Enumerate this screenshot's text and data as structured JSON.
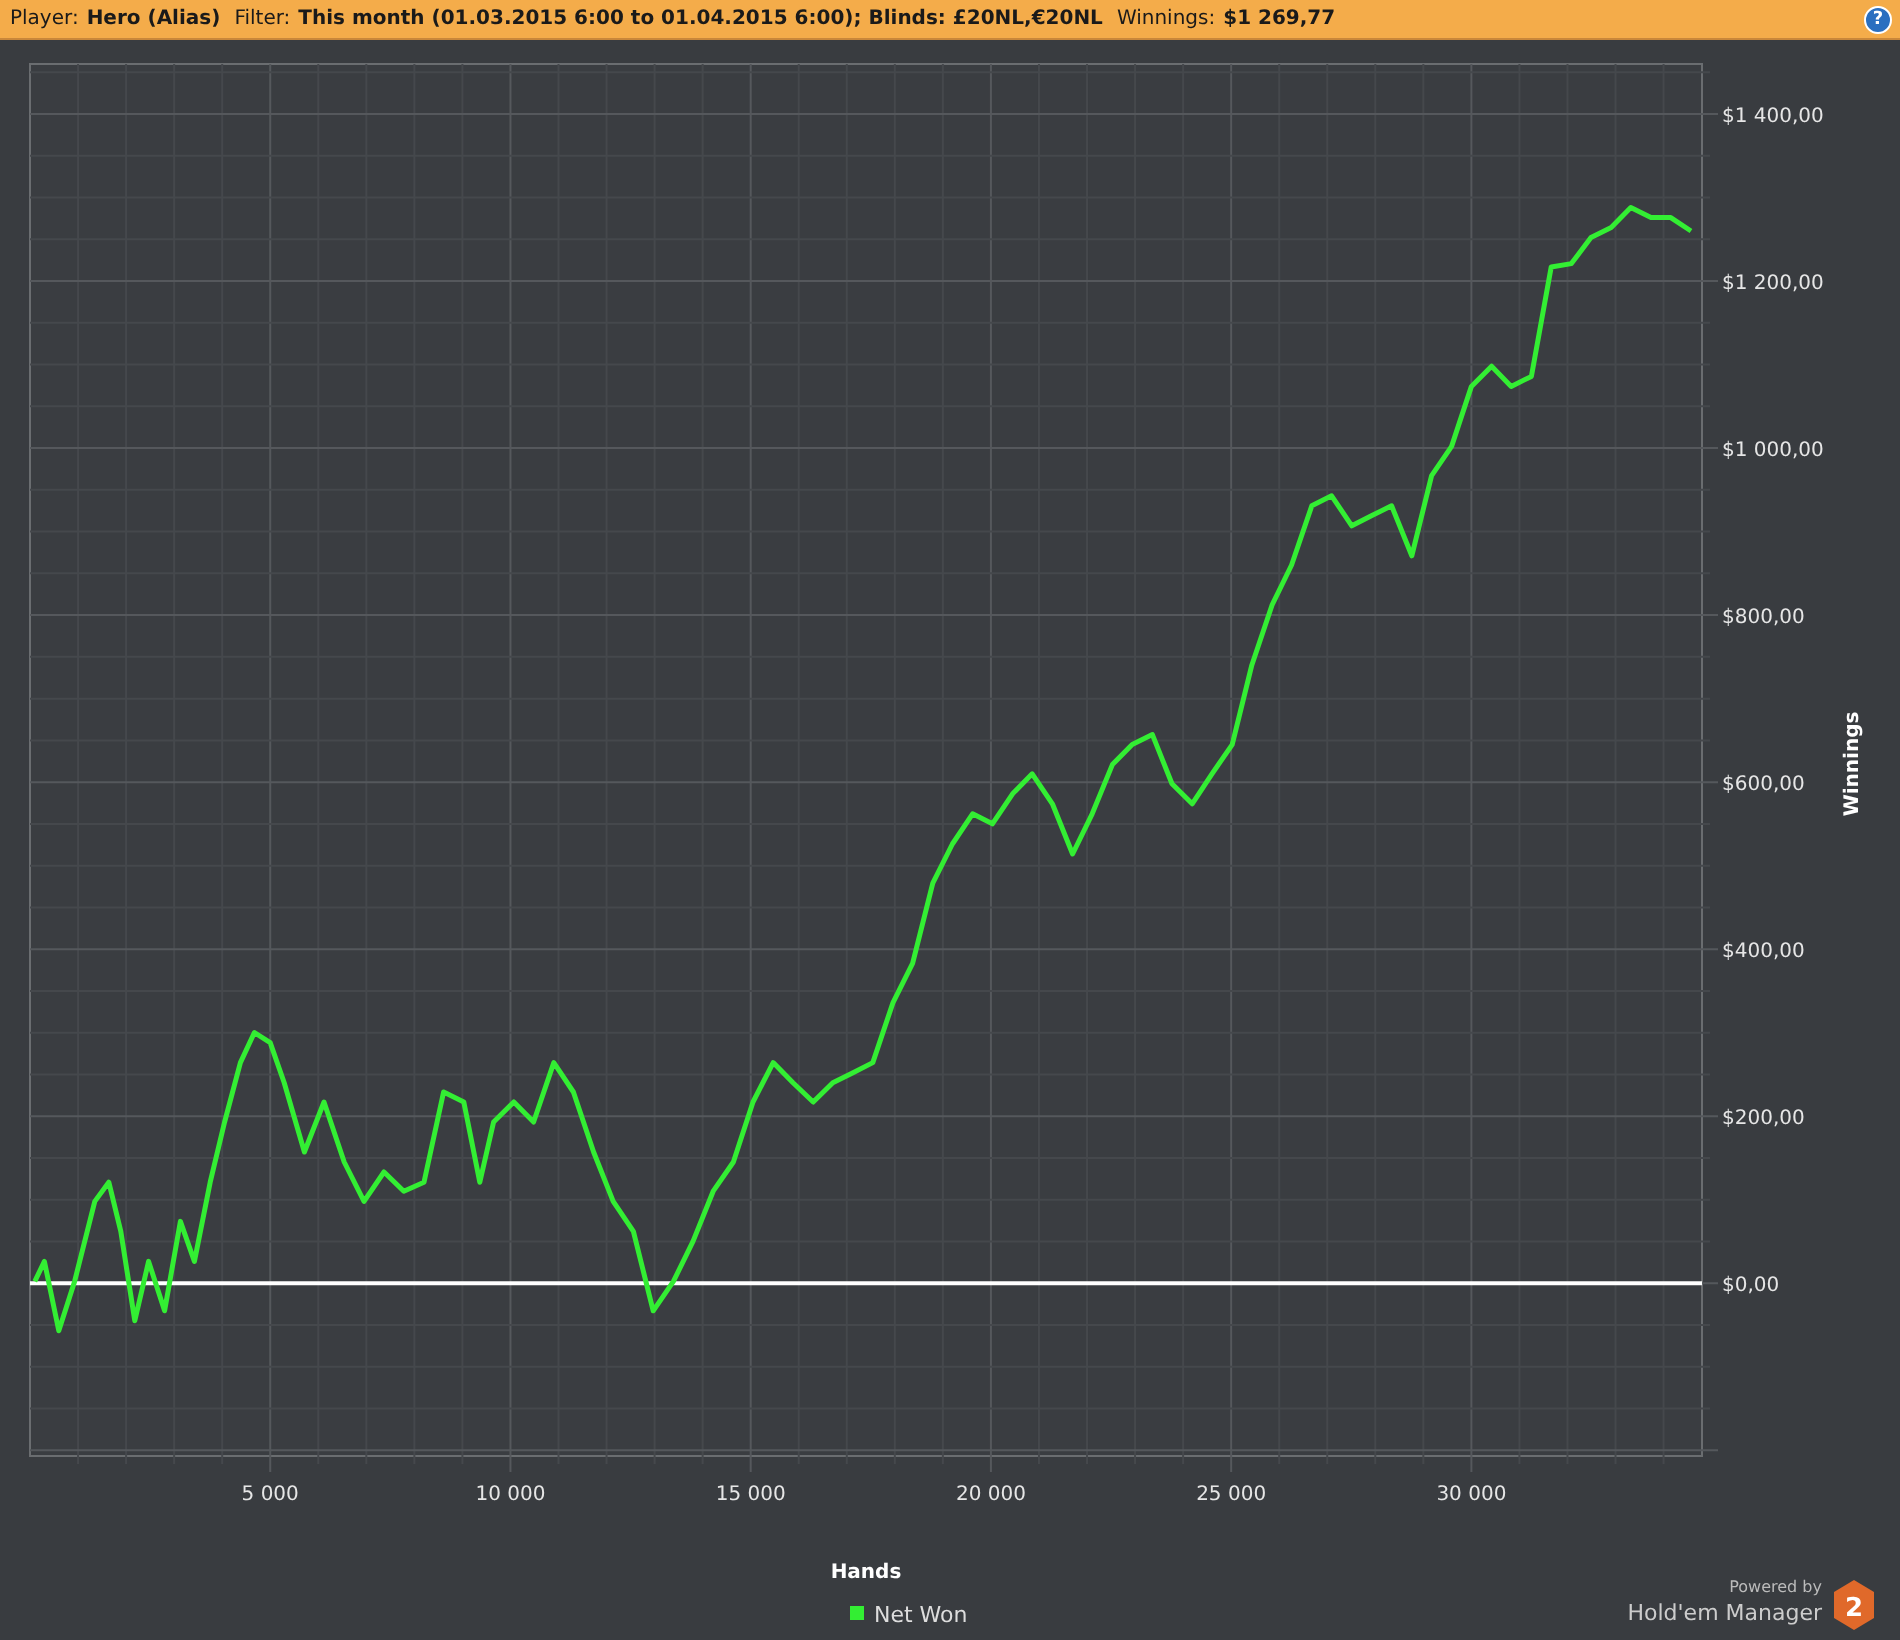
{
  "header": {
    "fields": [
      {
        "label": "Player:",
        "value": "Hero (Alias)"
      },
      {
        "label": "Filter:",
        "value": "This month (01.03.2015 6:00 to 01.04.2015 6:00); Blinds: £20NL,€20NL"
      },
      {
        "label": "Winnings:",
        "value": "$1 269,77"
      }
    ],
    "help_button": "?"
  },
  "chart": {
    "chart_data": {
      "type": "line",
      "grid": true,
      "xlabel": "Hands",
      "ylabel": "Winnings",
      "xlim": [
        0,
        34800
      ],
      "ylim": [
        -207,
        1460
      ],
      "xticks": [
        {
          "value": 5000,
          "label": "5 000"
        },
        {
          "value": 10000,
          "label": "10 000"
        },
        {
          "value": 15000,
          "label": "15 000"
        },
        {
          "value": 20000,
          "label": "20 000"
        },
        {
          "value": 25000,
          "label": "25 000"
        },
        {
          "value": 30000,
          "label": "30 000"
        }
      ],
      "yticks": [
        {
          "value": 0,
          "label": "$0,00"
        },
        {
          "value": 200,
          "label": "$200,00"
        },
        {
          "value": 400,
          "label": "$400,00"
        },
        {
          "value": 600,
          "label": "$600,00"
        },
        {
          "value": 800,
          "label": "$800,00"
        },
        {
          "value": 1000,
          "label": "$1 000,00"
        },
        {
          "value": 1200,
          "label": "$1 200,00"
        },
        {
          "value": 1400,
          "label": "$1 400,00"
        }
      ],
      "x": [
        100,
        300,
        600,
        930,
        1350,
        1640,
        1890,
        2180,
        2470,
        2800,
        3130,
        3420,
        3750,
        4050,
        4380,
        4670,
        5000,
        5290,
        5710,
        6120,
        6540,
        6950,
        7370,
        7780,
        8200,
        8610,
        9030,
        9360,
        9650,
        10070,
        10480,
        10900,
        11310,
        11730,
        12140,
        12560,
        12970,
        13390,
        13800,
        14220,
        14640,
        15050,
        15470,
        15880,
        16300,
        16710,
        17130,
        17540,
        17960,
        18370,
        18790,
        19200,
        19620,
        20030,
        20450,
        20860,
        21280,
        21700,
        22110,
        22530,
        22940,
        23360,
        23770,
        24190,
        24600,
        25020,
        25430,
        25850,
        26260,
        26680,
        27090,
        27510,
        27920,
        28340,
        28760,
        29170,
        29590,
        30000,
        30420,
        30830,
        31250,
        31660,
        32080,
        32490,
        32910,
        33320,
        33740,
        34150,
        34570
      ],
      "series": [
        {
          "name": "Net Won",
          "color": "#33ee33",
          "values": [
            2,
            26,
            -57,
            2,
            98,
            121,
            62,
            -45,
            26,
            -33,
            74,
            26,
            121,
            193,
            264,
            300,
            288,
            240,
            157,
            217,
            145,
            98,
            133,
            110,
            121,
            229,
            217,
            121,
            193,
            217,
            193,
            264,
            229,
            157,
            98,
            62,
            -33,
            2,
            50,
            110,
            145,
            217,
            264,
            240,
            217,
            240,
            252,
            264,
            336,
            383,
            479,
            526,
            562,
            550,
            586,
            610,
            574,
            514,
            562,
            621,
            645,
            657,
            598,
            574,
            610,
            645,
            740,
            812,
            860,
            931,
            943,
            907,
            919,
            931,
            871,
            967,
            1002,
            1074,
            1098,
            1074,
            1086,
            1217,
            1221,
            1252,
            1264,
            1288,
            1276,
            1276,
            1260
          ]
        }
      ]
    }
  },
  "branding": {
    "powered_by": "Powered by",
    "product": "Hold'em Manager",
    "version": "2"
  }
}
